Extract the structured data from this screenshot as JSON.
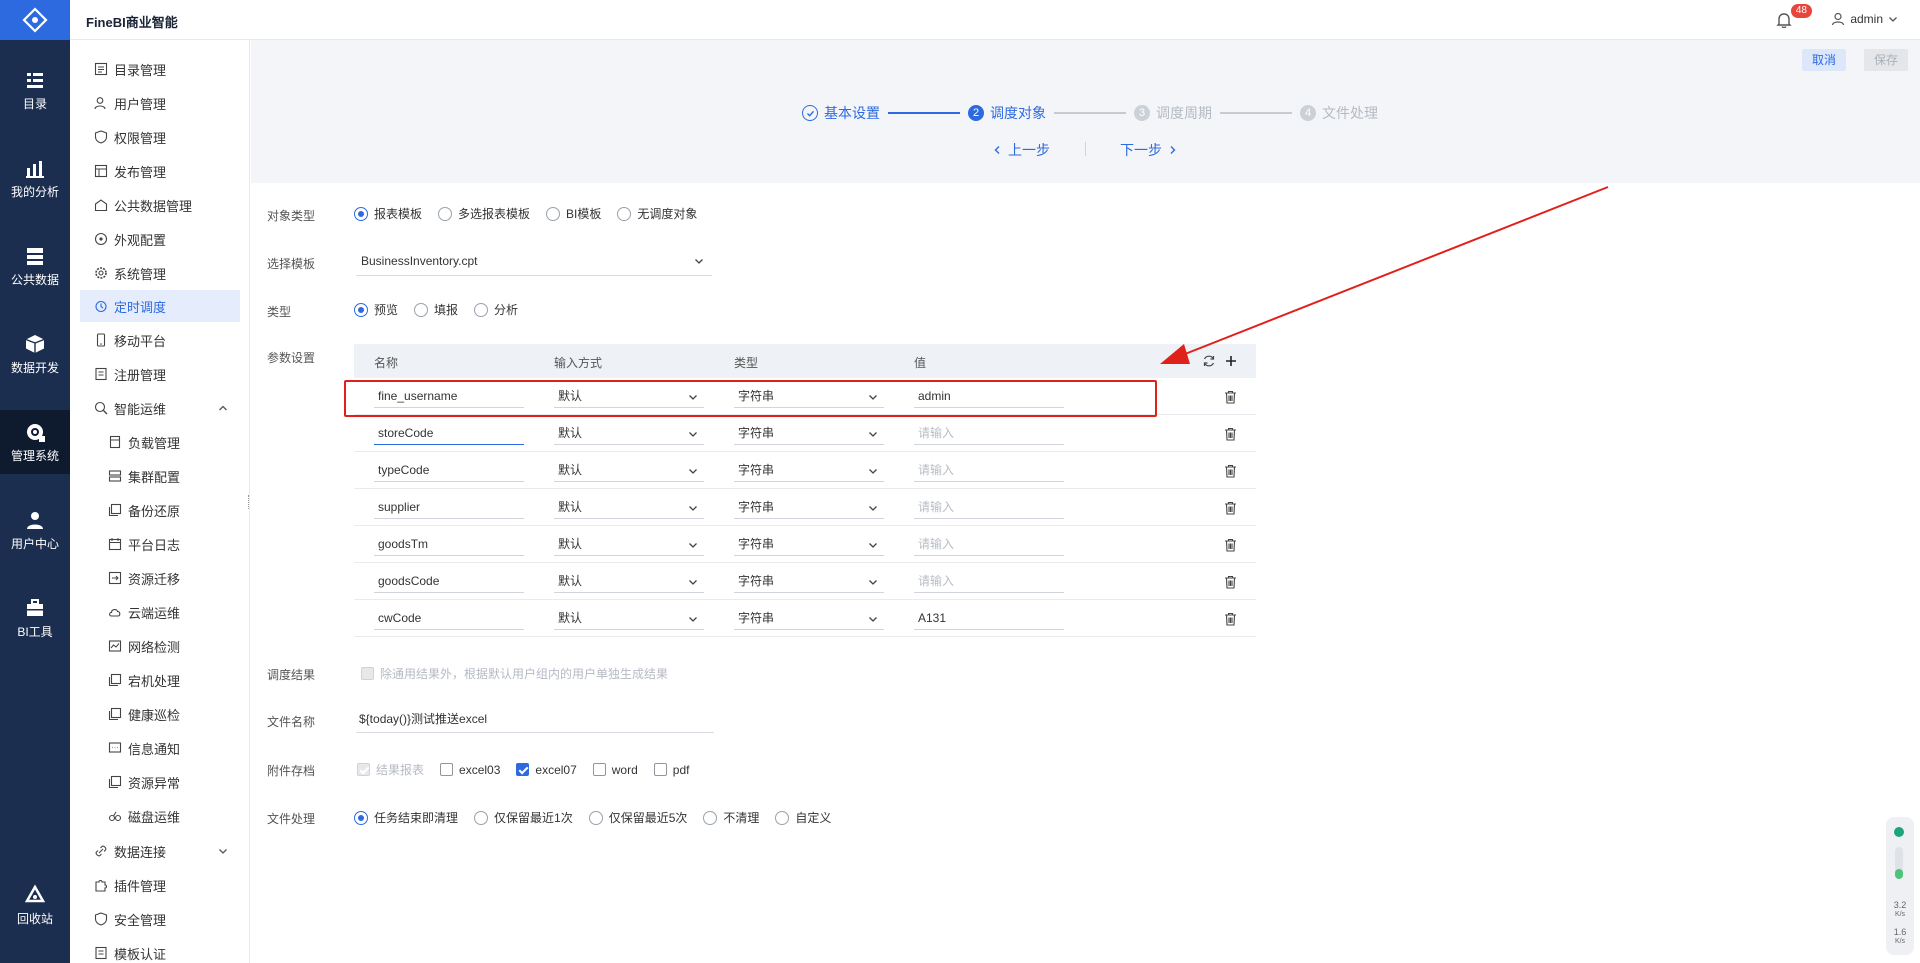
{
  "app": {
    "brand": "FineBI商业智能",
    "notifications": "48",
    "user": "admin"
  },
  "rail": [
    "目录",
    "我的分析",
    "公共数据",
    "数据开发",
    "管理系统",
    "用户中心",
    "BI工具",
    "回收站"
  ],
  "menu": {
    "items": [
      "目录管理",
      "用户管理",
      "权限管理",
      "发布管理",
      "公共数据管理",
      "外观配置",
      "系统管理",
      "定时调度",
      "移动平台",
      "注册管理",
      "智能运维"
    ],
    "sub_items": [
      "负载管理",
      "集群配置",
      "备份还原",
      "平台日志",
      "资源迁移",
      "云端运维",
      "网络检测",
      "宕机处理",
      "健康巡检",
      "信息通知",
      "资源异常",
      "磁盘运维"
    ],
    "bottom_items": [
      "数据连接",
      "插件管理",
      "安全管理",
      "模板认证"
    ]
  },
  "toolbar": {
    "cancel": "取消",
    "save": "保存"
  },
  "steps": [
    {
      "num": "",
      "label": "基本设置"
    },
    {
      "num": "2",
      "label": "调度对象"
    },
    {
      "num": "3",
      "label": "调度周期"
    },
    {
      "num": "4",
      "label": "文件处理"
    }
  ],
  "nav": {
    "prev": "上一步",
    "next": "下一步"
  },
  "form": {
    "object_type_label": "对象类型",
    "object_types": [
      "报表模板",
      "多选报表模板",
      "BI模板",
      "无调度对象"
    ],
    "template_label": "选择模板",
    "template_value": "BusinessInventory.cpt",
    "type_label": "类型",
    "types": [
      "预览",
      "填报",
      "分析"
    ],
    "params_label": "参数设置",
    "params_header": {
      "name": "名称",
      "input": "输入方式",
      "type": "类型",
      "value": "值"
    },
    "params": [
      {
        "name": "fine_username",
        "input": "默认",
        "type": "字符串",
        "value": "admin"
      },
      {
        "name": "storeCode",
        "input": "默认",
        "type": "字符串",
        "value": ""
      },
      {
        "name": "typeCode",
        "input": "默认",
        "type": "字符串",
        "value": ""
      },
      {
        "name": "supplier",
        "input": "默认",
        "type": "字符串",
        "value": ""
      },
      {
        "name": "goodsTm",
        "input": "默认",
        "type": "字符串",
        "value": ""
      },
      {
        "name": "goodsCode",
        "input": "默认",
        "type": "字符串",
        "value": ""
      },
      {
        "name": "cwCode",
        "input": "默认",
        "type": "字符串",
        "value": "A131"
      }
    ],
    "value_placeholder": "请输入",
    "result_label": "调度结果",
    "result_text": "除通用结果外，根据默认用户组内的用户单独生成结果",
    "filename_label": "文件名称",
    "filename_value": "${today()}测试推送excel",
    "attach_label": "附件存档",
    "attachments": [
      "结果报表",
      "excel03",
      "excel07",
      "word",
      "pdf"
    ],
    "fileproc_label": "文件处理",
    "fileproc_options": [
      "任务结束即清理",
      "仅保留最近1次",
      "仅保留最近5次",
      "不清理",
      "自定义"
    ]
  },
  "widget": {
    "up": "3.2",
    "up_unit": "K/s",
    "down": "1.6",
    "down_unit": "K/s"
  },
  "colors": {
    "accent": "#2d6ae0",
    "rail": "#1c2e4f",
    "highlight": "#e0211a"
  }
}
